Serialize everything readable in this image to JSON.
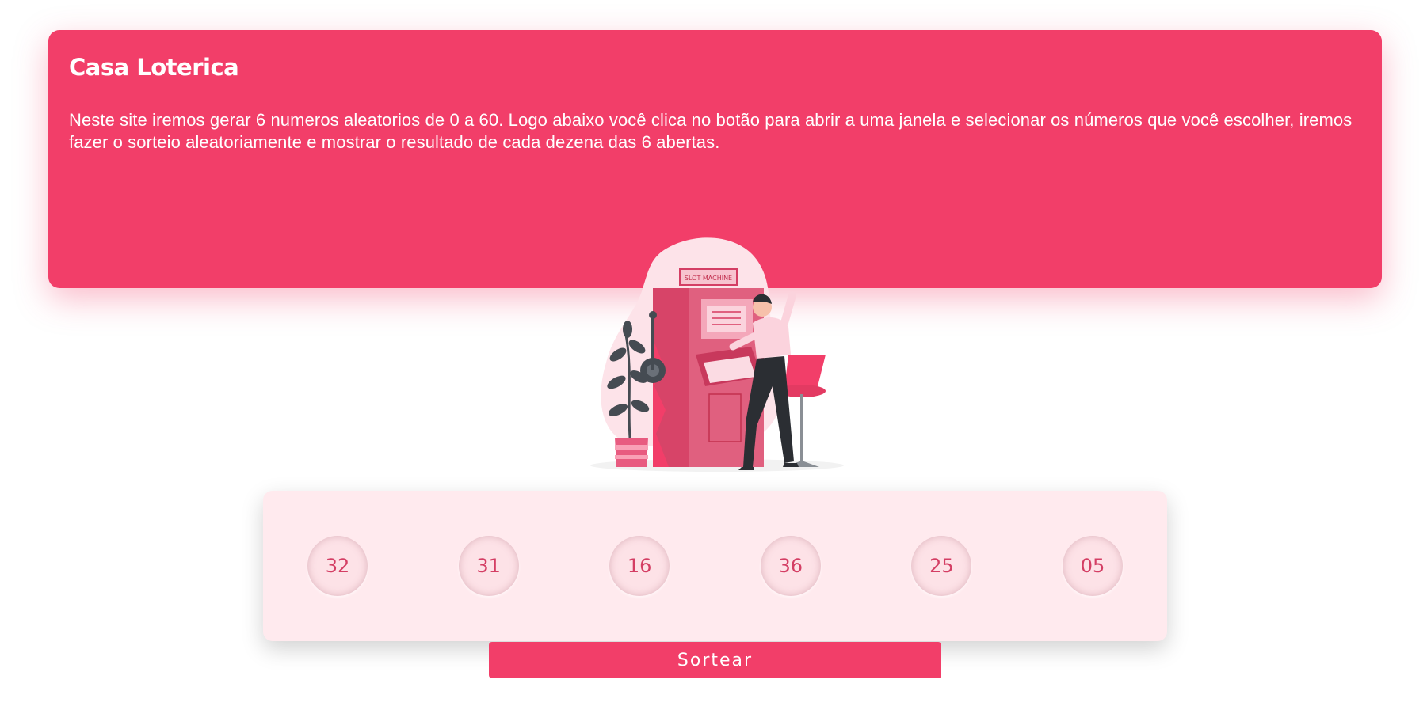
{
  "hero": {
    "title": "Casa Loterica",
    "description": "Neste site iremos gerar 6 numeros aleatorios de 0 a 60. Logo abaixo você clica no botão para abrir a uma janela e selecionar os números que você escolher, iremos fazer o sorteio aleatoriamente e mostrar o resultado de cada dezena das 6 abertas.",
    "background_color": "#f23e69"
  },
  "illustration": {
    "sign_text": "SLOT MACHINE",
    "icon": "slot-machine-illustration"
  },
  "numbers": {
    "balls": [
      "32",
      "31",
      "16",
      "36",
      "25",
      "05"
    ],
    "ball_text_color": "#d43e64",
    "panel_color": "#ffeaee"
  },
  "actions": {
    "draw_label": "Sortear",
    "accent": "#f23e69"
  }
}
